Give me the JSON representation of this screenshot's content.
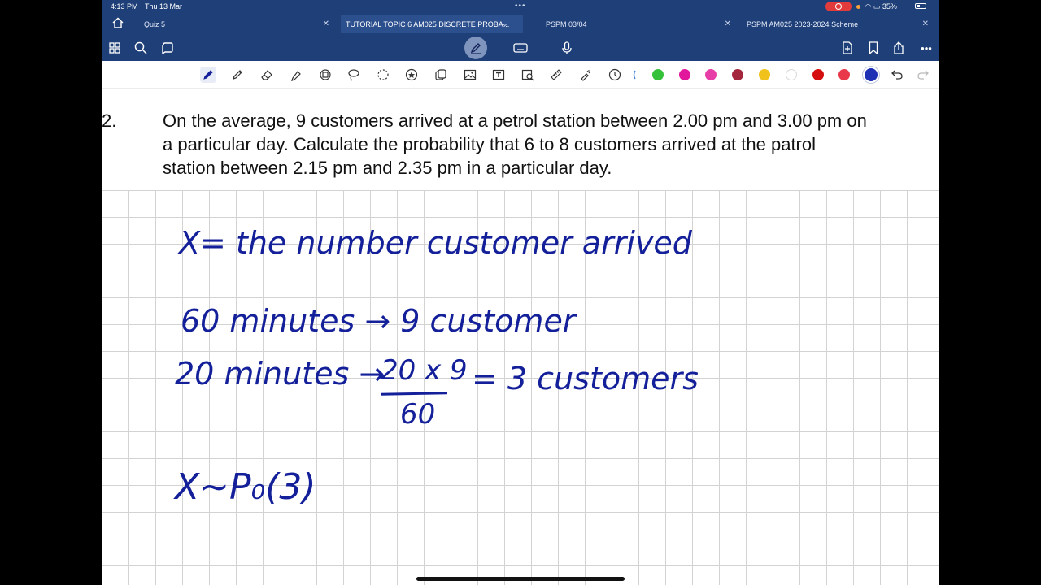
{
  "status_bar": {
    "time": "4:13 PM",
    "date": "Thu 13 Mar",
    "battery": "35%"
  },
  "tabs": [
    {
      "label": "Quiz 5"
    },
    {
      "label": "TUTORIAL TOPIC 6 AM025 DISCRETE PROBA..."
    },
    {
      "label": "PSPM 03/04"
    },
    {
      "label": "PSPM AM025 2023-2024 Scheme"
    }
  ],
  "toolbar": {
    "tools": [
      "pen-icon",
      "pencil-icon",
      "eraser-icon",
      "highlighter-icon",
      "shape-icon",
      "lasso-icon",
      "selection-icon",
      "sticker-icon",
      "element-icon",
      "image-icon",
      "text-icon",
      "scan-icon",
      "ruler-icon",
      "laser-pointer-icon",
      "timer-icon"
    ],
    "colors": [
      "#36c13a",
      "#e1189b",
      "#e63ea6",
      "#a3263c",
      "#f1c21b",
      "#ffffff",
      "#d50f0f",
      "#e8384a",
      "#1d2fb3"
    ]
  },
  "question": {
    "number": "2.",
    "lines": [
      "On the average, 9 customers arrived at a petrol station between 2.00 pm and 3.00 pm on",
      "a particular day. Calculate the probability that 6 to 8 customers arrived at the patrol",
      "station between 2.15 pm and 2.35 pm in a particular day."
    ]
  },
  "handwriting": {
    "line1": "X= the number customer arrived",
    "line2": "60 minutes → 9 customer",
    "line3_left": "20 minutes →",
    "frac_num": "20 x 9",
    "frac_den": "60",
    "line3_right": "= 3 customers",
    "line4": "X∼P₀(3)"
  },
  "colors": {
    "topbar": "#1e3f78",
    "ink": "#14209a"
  }
}
